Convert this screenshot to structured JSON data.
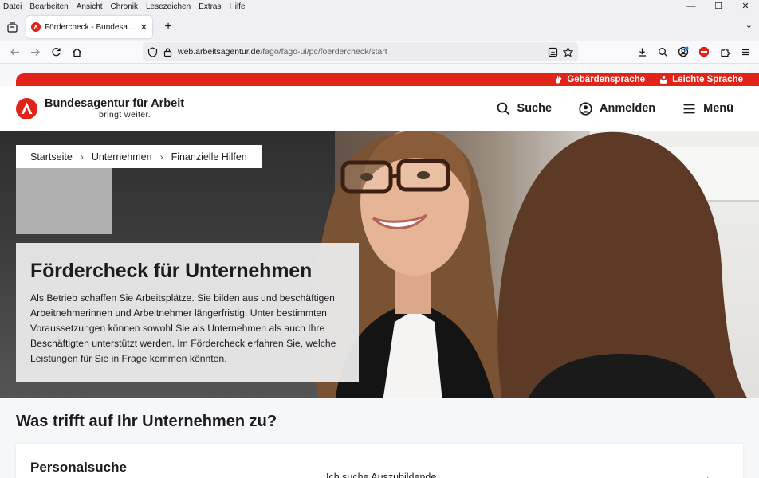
{
  "browser": {
    "menu": [
      "Datei",
      "Bearbeiten",
      "Ansicht",
      "Chronik",
      "Lesezeichen",
      "Extras",
      "Hilfe"
    ],
    "window_controls": {
      "minimize": "—",
      "maximize": "☐",
      "close": "✕"
    },
    "tab": {
      "title": "Fördercheck - Bundesagentur für Arbeit",
      "close": "✕"
    },
    "new_tab": "+",
    "tabs_overflow": "⌄",
    "url": {
      "host": "web.arbeitsagentur.de",
      "path": "/fago/fago-ui/pc/foerdercheck/start"
    }
  },
  "site": {
    "accessibility": {
      "sign_language": "Gebärdensprache",
      "easy_language": "Leichte Sprache"
    },
    "logo": {
      "title": "Bundesagentur für Arbeit",
      "subtitle": "bringt weiter."
    },
    "header": {
      "search": "Suche",
      "login": "Anmelden",
      "menu": "Menü"
    },
    "breadcrumb": [
      "Startseite",
      "Unternehmen",
      "Finanzielle Hilfen"
    ],
    "breadcrumb_separator": "›",
    "hero": {
      "title": "Fördercheck für Unternehmen",
      "text": "Als Betrieb schaffen Sie Arbeitsplätze. Sie bilden aus und beschäftigen Arbeitnehmerinnen und Arbeitnehmer längerfristig. Unter bestimmten Voraussetzungen können sowohl Sie als Unternehmen als auch Ihre Beschäftigten unterstützt werden. Im Fördercheck erfahren Sie, welche Leistungen für Sie in Frage kommen könnten."
    },
    "question": "Was trifft auf Ihr Unternehmen zu?",
    "card": {
      "title": "Personalsuche",
      "option": "Ich suche Auszubildende",
      "arrow": "→"
    }
  },
  "colors": {
    "brand_red": "#e2231a",
    "text": "#1c1b1f"
  }
}
